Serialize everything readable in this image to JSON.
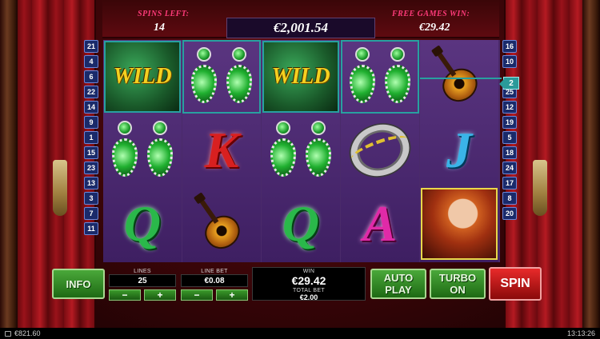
{
  "header": {
    "spins_left_label": "SPINS LEFT:",
    "spins_left_value": "14",
    "balance": "€2,001.54",
    "free_games_win_label": "FREE GAMES WIN:",
    "free_games_win_value": "€29.42"
  },
  "reels": [
    [
      "WILD",
      "earrings",
      "Q"
    ],
    [
      "earrings",
      "K",
      "guitar"
    ],
    [
      "WILD",
      "earrings",
      "Q"
    ],
    [
      "earrings",
      "tambourine",
      "A"
    ],
    [
      "guitar",
      "J",
      "lady"
    ]
  ],
  "line_numbers_left": [
    "21",
    "4",
    "6",
    "22",
    "14",
    "9",
    "1",
    "15",
    "23",
    "13",
    "3",
    "7",
    "11"
  ],
  "line_numbers_right": [
    "16",
    "10",
    "2",
    "25",
    "12",
    "19",
    "5",
    "18",
    "24",
    "17",
    "8",
    "20"
  ],
  "active_line": "2",
  "controls": {
    "info_label": "INFO",
    "lines_label": "LINES",
    "lines_value": "25",
    "line_bet_label": "LINE BET",
    "line_bet_value": "€0.08",
    "minus": "−",
    "plus": "+",
    "win_label": "WIN",
    "win_value": "€29.42",
    "total_bet_label": "TOTAL BET",
    "total_bet_value": "€2.00",
    "auto_play_label": "AUTO PLAY",
    "turbo_label": "TURBO ON",
    "spin_label": "SPIN"
  },
  "status": {
    "wallet": "€821.60",
    "time": "13:13:26"
  },
  "colors": {
    "highlight": "#28a0a0",
    "wild_frame": "#e8d84a",
    "button_green": "#2e8a22",
    "spin_red": "#c81a1a"
  }
}
